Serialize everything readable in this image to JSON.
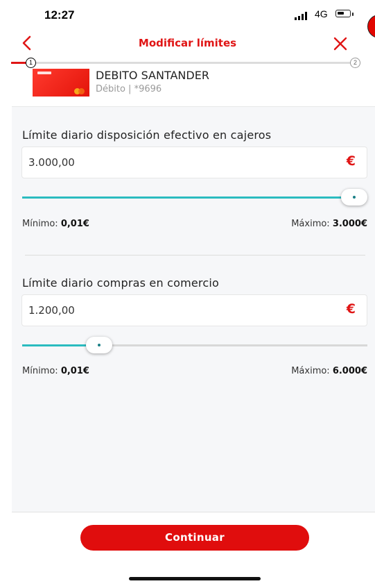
{
  "status_bar": {
    "time": "12:27",
    "network": "4G"
  },
  "header": {
    "title": "Modificar límites",
    "back_icon": "chevron-left-icon",
    "close_icon": "close-icon"
  },
  "stepper": {
    "current_step": "1",
    "next_step": "2"
  },
  "card": {
    "name": "DEBITO SANTANDER",
    "subtitle": "Débito | *9696"
  },
  "limits": [
    {
      "title": "Límite diario disposición efectivo en cajeros",
      "value": "3.000,00",
      "currency": "€",
      "slider_fraction": 1.0,
      "min_label": "Mínimo: ",
      "min_value": "0,01€",
      "max_label": "Máximo: ",
      "max_value": "3.000€"
    },
    {
      "title": "Límite diario compras en comercio",
      "value": "1.200,00",
      "currency": "€",
      "slider_fraction": 0.2,
      "min_label": "Mínimo: ",
      "min_value": "0,01€",
      "max_label": "Máximo: ",
      "max_value": "6.000€"
    }
  ],
  "actions": {
    "continue_label": "Continuar"
  },
  "colors": {
    "brand_red": "#e01515",
    "slider_teal": "#2bbcc0",
    "panel_bg": "#f6f7f9"
  }
}
